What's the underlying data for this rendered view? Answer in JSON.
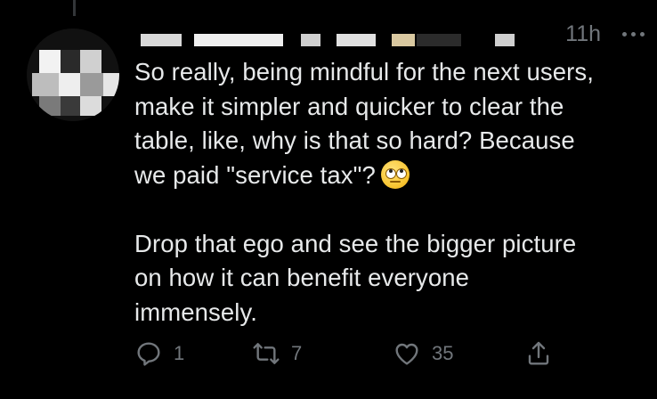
{
  "tweet": {
    "timestamp": "11h",
    "text": "So really, being mindful for the next users,\nmake it simpler and quicker to clear the\ntable, like, why is that so hard? Because\nwe paid \"service tax\"?",
    "emoji": "face-with-rolling-eyes",
    "text2": "Drop that ego and see the bigger picture\non how it can benefit everyone\nimmensely."
  },
  "actions": {
    "reply_count": "1",
    "retweet_count": "7",
    "like_count": "35"
  },
  "colors": {
    "background": "#000000",
    "text": "#e7e9ea",
    "muted": "#71767b"
  }
}
